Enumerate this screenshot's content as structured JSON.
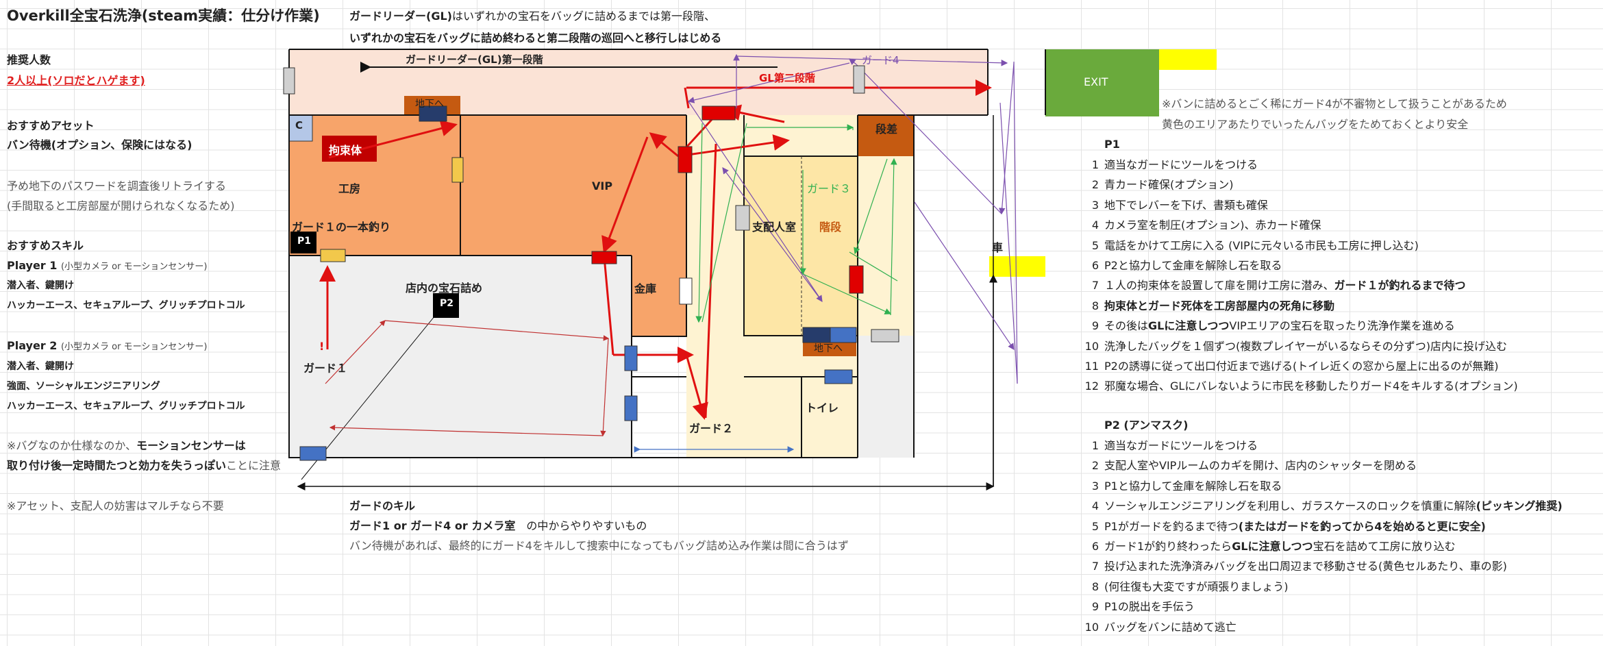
{
  "title": "Overkill全宝石洗浄(steam実績：仕分け作業)",
  "header_note": {
    "line1_bold": "ガードリーダー(GL)",
    "line1_rest": "はいずれかの宝石をバッグに詰めるまでは第一段階、",
    "line2": "いずれかの宝石をバッグに詰め終わると第二段階の巡回へと移行しはじめる"
  },
  "left_panel": {
    "players_label": "推奨人数",
    "players_value": "2人以上(ソロだとハゲます)",
    "assets_label": "おすすめアセット",
    "assets_value": "バン待機(オプション、保険にはなる)",
    "retry_note1": "予め地下のパスワードを調査後リトライする",
    "retry_note2": "(手間取ると工房部屋が開けられなくなるため)",
    "skills_label": "おすすめスキル",
    "p1_label": "Player 1",
    "p1_sub": "(小型カメラ or モーションセンサー)",
    "p1_skill1": "潜入者、鍵開け",
    "p1_skill2": "ハッカーエース、セキュアループ、グリッチプロトコル",
    "p2_label": "Player 2",
    "p2_sub": "(小型カメラ or モーションセンサー)",
    "p2_skill1": "潜入者、鍵開け",
    "p2_skill2": "強面、ソーシャルエンジニアリング",
    "p2_skill3": "ハッカーエース、セキュアループ、グリッチプロトコル",
    "bug_note1a": "※バグなのか仕様なのか、",
    "bug_note1b": "モーションセンサーは",
    "bug_note2a": "取り付け後一定時間たつと効力を失うっぽい",
    "bug_note2b": "ことに注意",
    "asset_note": "※アセット、支配人の妨害はマルチなら不要"
  },
  "kill_section": {
    "heading": "ガードのキル",
    "line1": "ガード1 or ガード4 or カメラ室",
    "line1_rest": "の中からやりやすいもの",
    "line2": "バン待機があれば、最終的にガード4をキルして捜索中になってもバッグ詰め込み作業は間に合うはず"
  },
  "map": {
    "gl_phase1": "ガードリーダー(GL)第一段階",
    "gl_phase2": "GL第二段階",
    "guard4": "ガード4",
    "basement": "地下へ",
    "basement2": "地下へ",
    "camera": "C",
    "restraint": "拘束体",
    "workshop": "工房",
    "vip": "VIP",
    "guard1_fish": "ガード１の一本釣り",
    "p1": "P1",
    "p2": "P2",
    "shop_gems": "店内の宝石詰め",
    "guard1": "ガード１",
    "alert": "!",
    "vault": "金庫",
    "manager_room": "支配人室",
    "stairs": "階段",
    "guard3": "ガード３",
    "step": "段差",
    "guard2": "ガード２",
    "toilet": "トイレ",
    "exit": "EXIT",
    "car": "車"
  },
  "right_panel": {
    "note1": "※バンに詰めるとごく稀にガード4が不審物として扱うことがあるため",
    "note2": "黄色のエリアあたりでいったんバッグをためておくとより安全",
    "p1_heading": "P1",
    "p1_steps": [
      {
        "n": "1",
        "text": "適当なガードにツールをつける"
      },
      {
        "n": "2",
        "text": "青カード確保(オプション)"
      },
      {
        "n": "3",
        "text": "地下でレバーを下げ、書類も確保"
      },
      {
        "n": "4",
        "text": "カメラ室を制圧(オプション)、赤カード確保"
      },
      {
        "n": "5",
        "text": "電話をかけて工房に入る (VIPに元々いる市民も工房に押し込む)"
      },
      {
        "n": "6",
        "text": "P2と協力して金庫を解除し石を取る"
      },
      {
        "n": "7",
        "text": "１人の拘束体を設置して扉を開け工房に潜み、",
        "bold": "ガード１が釣れるまで待つ"
      },
      {
        "n": "8",
        "text": "",
        "bold": "拘束体とガード死体を工房部屋内の死角に移動"
      },
      {
        "n": "9",
        "text": "その後は",
        "bold": "GLに注意しつつ",
        "rest": "VIPエリアの宝石を取ったり洗浄作業を進める"
      },
      {
        "n": "10",
        "text": "洗浄したバッグを１個ずつ(複数プレイヤーがいるならその分ずつ)店内に投げ込む"
      },
      {
        "n": "11",
        "text": "P2の誘導に従って出口付近まで逃げる(トイレ近くの窓から屋上に出るのが無難)"
      },
      {
        "n": "12",
        "text": "邪魔な場合、GLにバレないように市民を移動したりガード4をキルする(オプション)"
      }
    ],
    "p2_heading": "P2 (アンマスク)",
    "p2_steps": [
      {
        "n": "1",
        "text": "適当なガードにツールをつける"
      },
      {
        "n": "2",
        "text": "支配人室やVIPルームのカギを開け、店内のシャッターを閉める"
      },
      {
        "n": "3",
        "text": "P1と協力して金庫を解除し石を取る"
      },
      {
        "n": "4",
        "text": "ソーシャルエンジニアリングを利用し、ガラスケースのロックを慎重に解除",
        "bold": "(ピッキング推奨)"
      },
      {
        "n": "5",
        "text": "P1がガードを釣るまで待つ",
        "bold": "(またはガードを釣ってから4を始めると更に安全)"
      },
      {
        "n": "6",
        "text": "ガード1が釣り終わったら",
        "bold": "GLに注意しつつ",
        "rest": "宝石を詰めて工房に放り込む"
      },
      {
        "n": "7",
        "text": "投げ込まれた洗浄済みバッグを出口周辺まで移動させる(黄色セルあたり、車の影)"
      },
      {
        "n": "8",
        "text": "(何往復も大変ですが頑張りましょう)"
      },
      {
        "n": "9",
        "text": "P1の脱出を手伝う"
      },
      {
        "n": "10",
        "text": "バッグをバンに詰めて逃亡"
      }
    ]
  },
  "colors": {
    "corridor_top": "#fbe3d6",
    "workshop": "#f7a46a",
    "vip": "#f7a46a",
    "manager": "#fde6a6",
    "lobby": "#fef3d2",
    "shop": "#efefef",
    "exit": "#6aaa3c",
    "yellow": "#ffff00",
    "route_red": "#e01010",
    "route_purple": "#7b4fae",
    "route_green": "#30b050",
    "door_blue": "#4472c4",
    "door_red": "#e00000"
  }
}
